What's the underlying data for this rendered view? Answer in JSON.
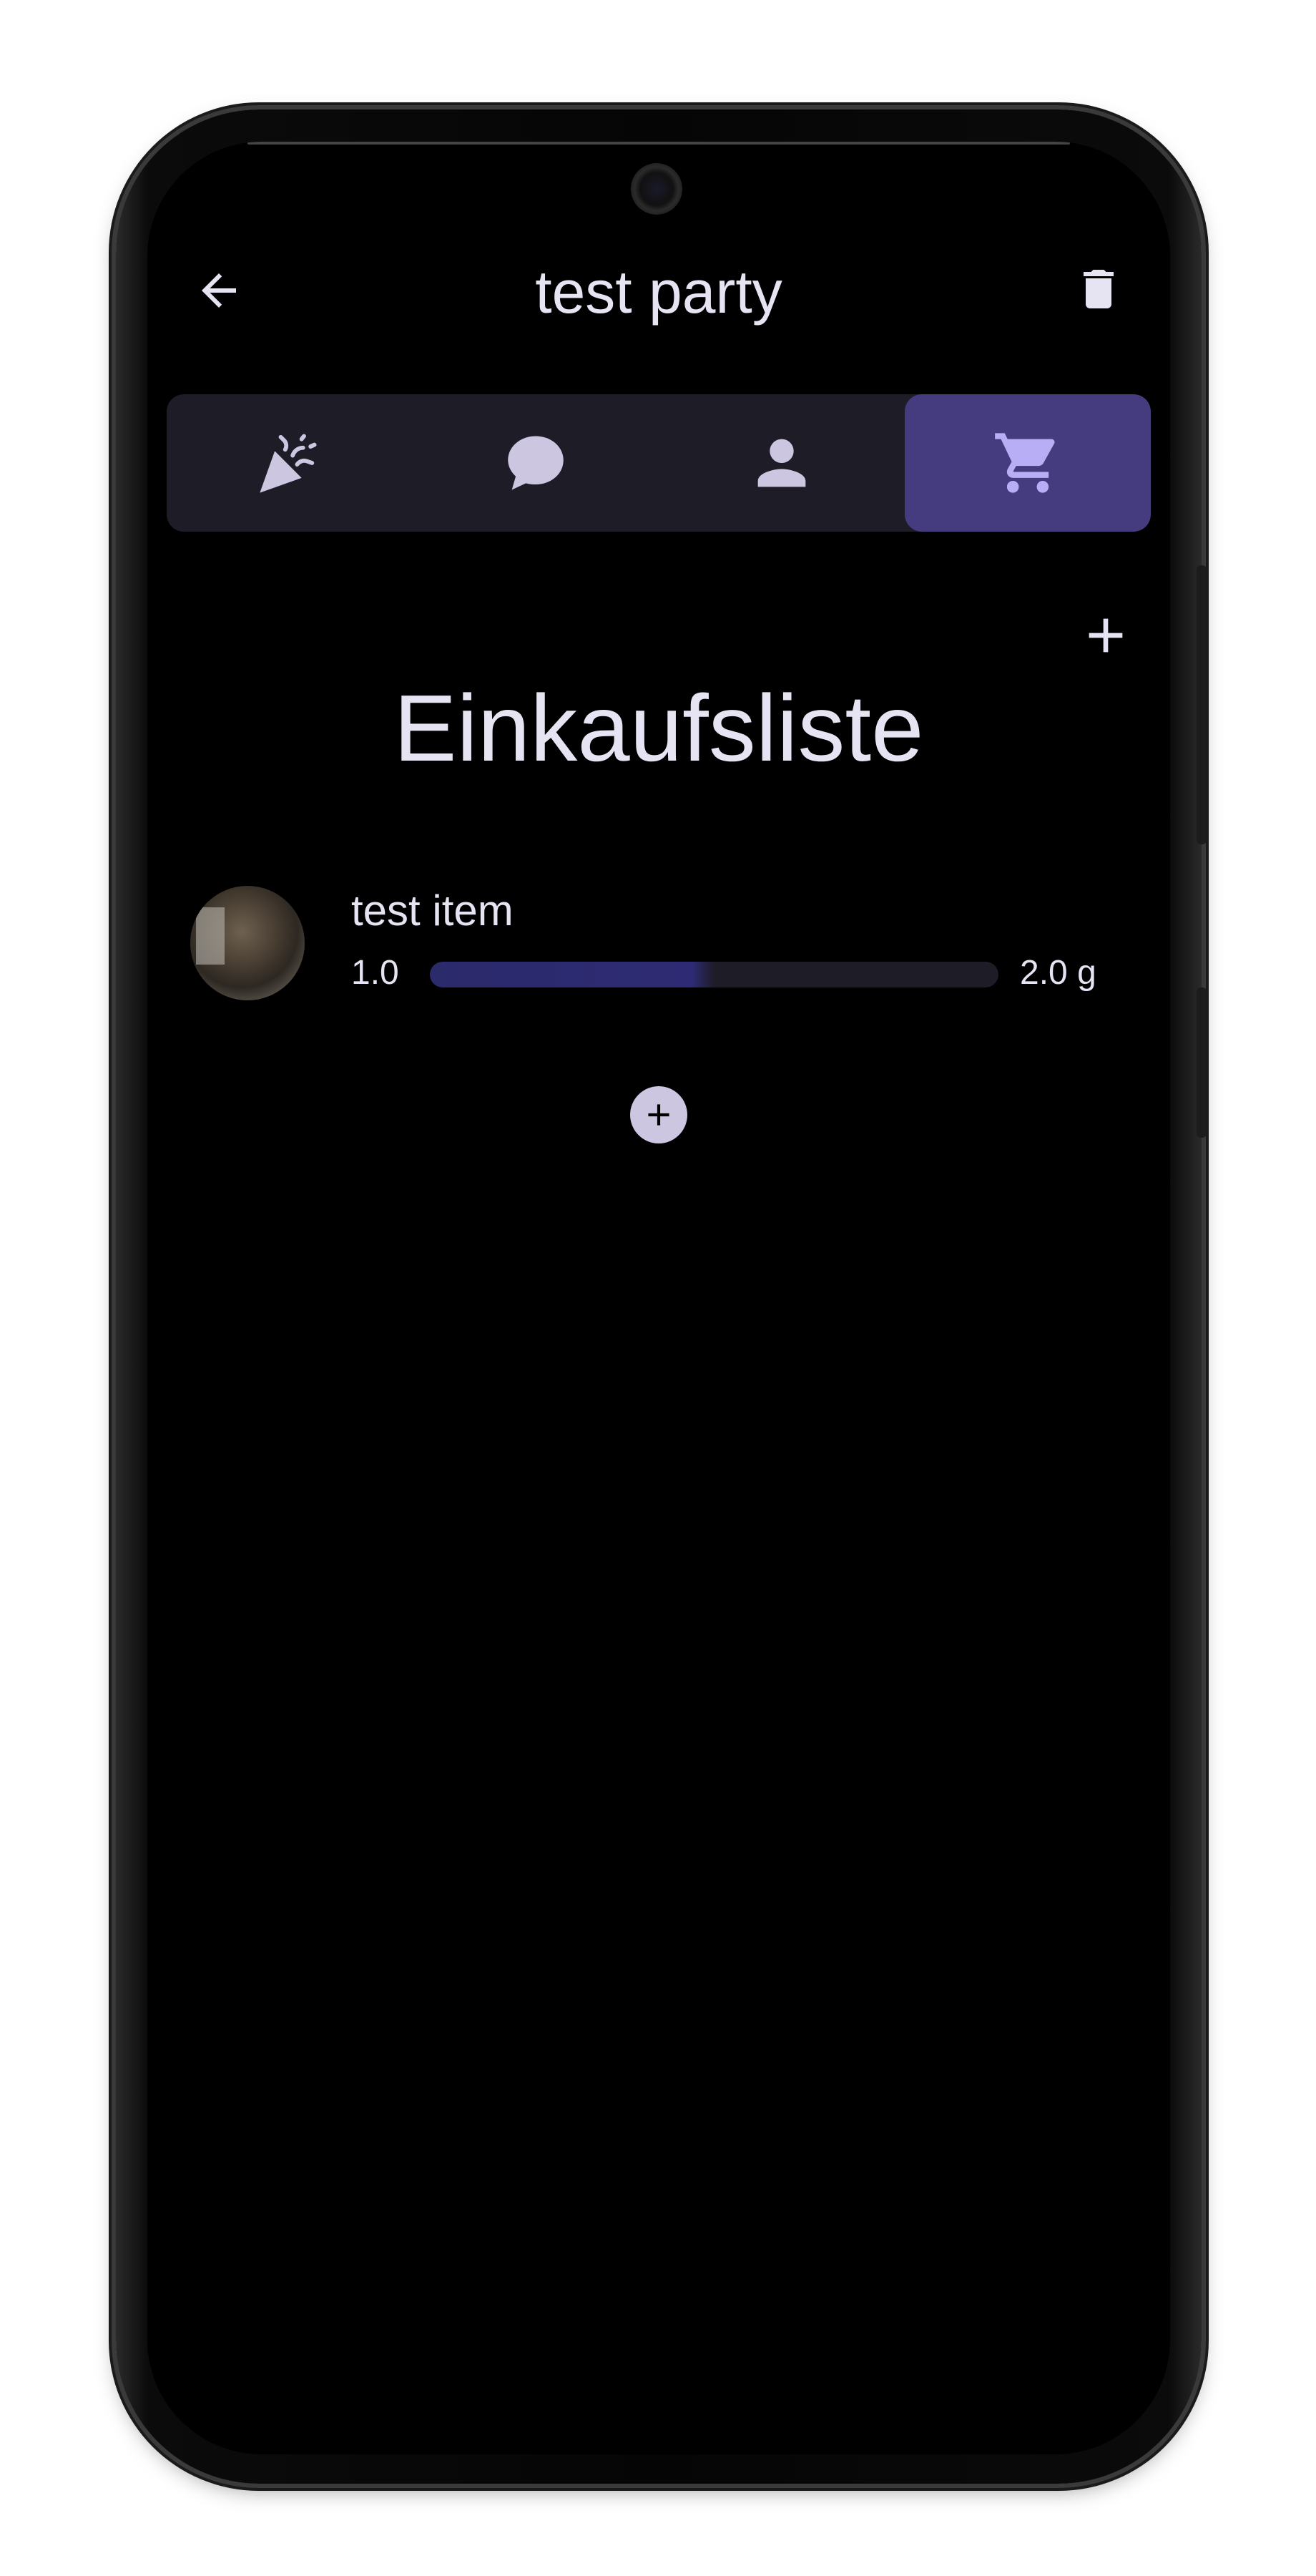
{
  "app_bar": {
    "title": "test party",
    "back_icon": "arrow-left-icon",
    "delete_icon": "trash-icon"
  },
  "tabs": [
    {
      "icon": "party-popper-icon",
      "active": false
    },
    {
      "icon": "chat-bubble-icon",
      "active": false
    },
    {
      "icon": "person-icon",
      "active": false
    },
    {
      "icon": "shopping-cart-icon",
      "active": true
    }
  ],
  "main": {
    "heading": "Einkaufsliste",
    "add_icon": "plus-icon"
  },
  "items": [
    {
      "name": "test item",
      "min": "1.0",
      "max": "2.0 g",
      "progress_fraction": 0.5
    }
  ],
  "add_item_icon": "plus-circle-icon",
  "colors": {
    "background": "#000000",
    "surface": "#1d1c27",
    "accent": "#443c7e",
    "active_icon": "#b8aef5",
    "text": "#e6e3f2",
    "progress": "#2e2b74"
  }
}
